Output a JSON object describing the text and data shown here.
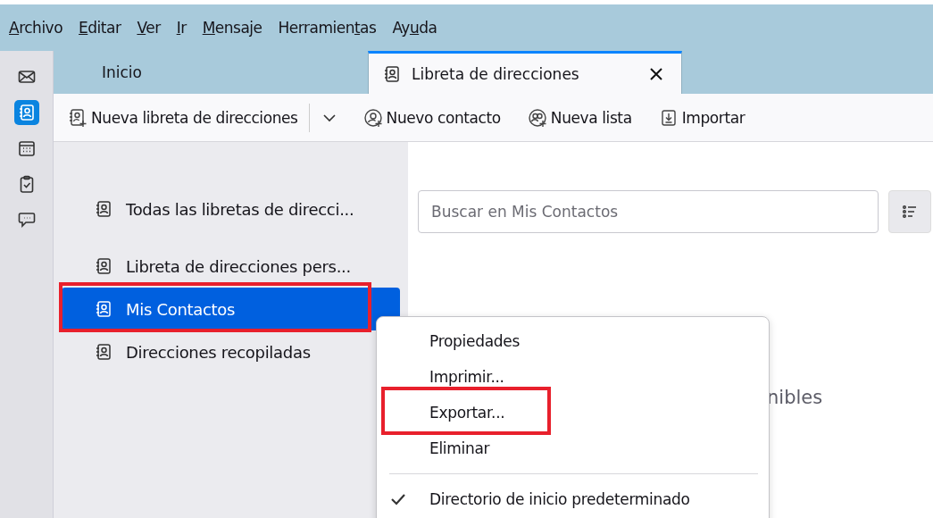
{
  "menubar": [
    {
      "key": "A",
      "post": "rchivo"
    },
    {
      "key": "E",
      "post": "ditar"
    },
    {
      "key": "V",
      "post": "er"
    },
    {
      "key": "I",
      "post": "r"
    },
    {
      "key": "M",
      "post": "ensaje"
    },
    {
      "pre": "Herramien",
      "key": "t",
      "post": "as"
    },
    {
      "pre": "Ay",
      "key": "u",
      "post": "da"
    }
  ],
  "spaces": [
    {
      "kind": "mail",
      "selected": false
    },
    {
      "kind": "addressbook",
      "selected": true
    },
    {
      "kind": "calendar",
      "selected": false
    },
    {
      "kind": "tasks",
      "selected": false
    },
    {
      "kind": "chat",
      "selected": false
    }
  ],
  "tabs": [
    {
      "label": "Inicio",
      "selected": false
    },
    {
      "label": "Libreta de direcciones",
      "selected": true
    }
  ],
  "toolbar": [
    {
      "label": "Nueva libreta de direcciones",
      "kind": "book"
    },
    {
      "kind": "dropdown"
    },
    {
      "label": "Nuevo contacto",
      "kind": "contact"
    },
    {
      "label": "Nueva lista",
      "kind": "list"
    },
    {
      "label": "Importar",
      "kind": "import"
    }
  ],
  "sidebar": {
    "items": [
      {
        "label": "Todas las libretas de direcci...",
        "selected": false,
        "annotated": false
      },
      {
        "label": "Libreta de direcciones pers...",
        "selected": false,
        "annotated": false
      },
      {
        "label": "Mis Contactos",
        "selected": true,
        "annotated": true
      },
      {
        "label": "Direcciones recopiladas",
        "selected": false,
        "annotated": false
      }
    ]
  },
  "search": {
    "placeholder": "Buscar en Mis Contactos"
  },
  "empty_text": "nibles",
  "context_menu": {
    "items": [
      {
        "label": "Propiedades",
        "kind": "item",
        "checked": false,
        "annotated": false
      },
      {
        "label": "Imprimir...",
        "kind": "item",
        "checked": false,
        "annotated": false
      },
      {
        "label": "Exportar...",
        "kind": "item",
        "checked": false,
        "annotated": true
      },
      {
        "label": "Eliminar",
        "kind": "item",
        "checked": false,
        "annotated": false
      },
      {
        "kind": "separator"
      },
      {
        "label": "Directorio de inicio predeterminado",
        "kind": "item",
        "checked": true,
        "annotated": false
      }
    ]
  }
}
